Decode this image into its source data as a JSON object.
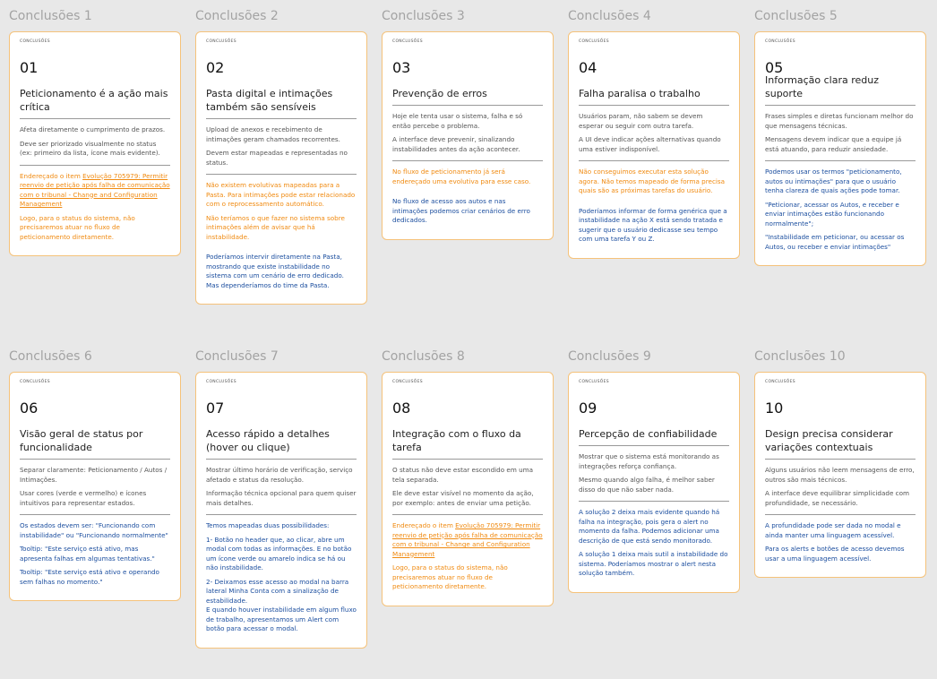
{
  "tag": "CONCLUSÕES",
  "cards": [
    {
      "title": "Conclusões 1",
      "num": "01",
      "heading": "Peticionamento é a ação mais crítica",
      "body": [
        "Afeta diretamente o cumprimento de prazos.",
        "Deve ser priorizado visualmente no status (ex: primeiro da lista, ícone mais evidente)."
      ],
      "orange": [
        {
          "pre": "Endereçado o item ",
          "link": "Evolução 705979: Permitir reenvio de petição após falha de comunicação com o tribunal - Change and Configuration Management"
        },
        {
          "text": "Logo, para o status do sistema, não precisaremos atuar no fluxo de peticionamento diretamente."
        }
      ],
      "blue": []
    },
    {
      "title": "Conclusões 2",
      "num": "02",
      "heading": "Pasta digital e intimações também são sensíveis",
      "body": [
        "Upload de anexos e recebimento de intimações geram chamados recorrentes.",
        "Devem estar mapeadas e representadas no status."
      ],
      "orange": [
        {
          "text": "Não existem evolutivas mapeadas para a Pasta. Para intimações pode estar relacionado com o reprocessamento automático."
        },
        {
          "text": "Não teríamos o que fazer no sistema sobre intimações além de avisar que há instabilidade."
        }
      ],
      "blue": [
        "Poderíamos intervir diretamente na Pasta, mostrando que existe instabilidade no sistema com um cenário de erro dedicado. Mas dependeríamos do time da Pasta."
      ]
    },
    {
      "title": "Conclusões 3",
      "num": "03",
      "heading": "Prevenção de erros",
      "body": [
        "Hoje ele tenta usar o sistema, falha e só então percebe o problema.",
        "A interface deve prevenir, sinalizando instabilidades antes da ação acontecer."
      ],
      "orange": [
        {
          "text": "No fluxo de peticionamento já será endereçado uma evolutiva para esse caso."
        }
      ],
      "blue": [
        "No fluxo de acesso aos autos e nas intimações podemos criar cenários de erro dedicados."
      ]
    },
    {
      "title": "Conclusões 4",
      "num": "04",
      "heading": "Falha paralisa o trabalho",
      "body": [
        "Usuários param, não sabem se devem esperar ou seguir com outra tarefa.",
        "A UI deve indicar ações alternativas quando uma estiver indisponível."
      ],
      "orange": [
        {
          "text": "Não conseguimos executar esta solução agora. Não temos mapeado de forma precisa quais são as próximas tarefas do usuário."
        }
      ],
      "blue": [
        "Poderíamos informar de forma genérica que a instabilidade na ação X está sendo tratada e sugerir que o usuário dedicasse seu tempo com uma tarefa Y ou Z."
      ]
    },
    {
      "title": "Conclusões 5",
      "num": "05",
      "heading": "Informação clara reduz suporte",
      "body": [
        "Frases simples e diretas funcionam melhor do que mensagens técnicas.",
        "Mensagens devem indicar que a equipe já está atuando, para reduzir ansiedade."
      ],
      "orange": [],
      "blue": [
        "Podemos usar os termos \"peticionamento, autos ou intimações\" para que o usuário tenha clareza de quais ações pode tomar.",
        "\"Peticionar, acessar os Autos, e receber e enviar intimações estão funcionando normalmente\";",
        "\"Instabilidade em peticionar, ou acessar os Autos, ou receber e enviar intimações\""
      ]
    },
    {
      "title": "Conclusões 6",
      "num": "06",
      "heading": "Visão geral de status por funcionalidade",
      "body": [
        "Separar claramente: Peticionamento / Autos / Intimações.",
        "Usar cores (verde e vermelho) e ícones intuitivos para representar estados."
      ],
      "orange": [],
      "blue": [
        "Os estados devem ser: \"Funcionando com instabilidade\" ou \"Funcionando normalmente\"",
        "Tooltip: \"Este serviço está ativo, mas apresenta falhas em algumas tentativas.\"",
        "Tooltip: \"Este serviço está ativo e operando sem falhas no momento.\""
      ]
    },
    {
      "title": "Conclusões 7",
      "num": "07",
      "heading": "Acesso rápido a detalhes (hover ou clique)",
      "body": [
        "Mostrar último horário de verificação, serviço afetado e status da resolução.",
        "Informação técnica opcional para quem quiser mais detalhes."
      ],
      "orange": [],
      "blue": [
        "Temos mapeadas duas possibilidades:",
        "1- Botão no header que, ao clicar, abre um modal com todas as informações. E no botão um ícone verde ou amarelo indica se há ou não instabilidade.",
        "2- Deixamos esse acesso ao modal na barra lateral Minha Conta com a sinalização de estabilidade.\nE quando houver instabilidade em algum fluxo de trabalho, apresentamos um Alert com botão para acessar o modal."
      ]
    },
    {
      "title": "Conclusões 8",
      "num": "08",
      "heading": "Integração com o fluxo da tarefa",
      "body": [
        "O status não deve estar escondido em uma tela separada.",
        "Ele deve estar visível no momento da ação, por exemplo: antes de enviar uma petição."
      ],
      "orange": [
        {
          "pre": "Endereçado o item ",
          "link": "Evolução 705979: Permitir reenvio de petição após falha de comunicação com o tribunal - Change and Configuration Management"
        },
        {
          "text": "Logo, para o status do sistema, não precisaremos atuar no fluxo de peticionamento diretamente."
        }
      ],
      "blue": []
    },
    {
      "title": "Conclusões 9",
      "num": "09",
      "heading": "Percepção de confiabilidade",
      "body": [
        "Mostrar que o sistema está monitorando as integrações reforça confiança.",
        "Mesmo quando algo falha, é melhor saber disso do que não saber nada."
      ],
      "orange": [],
      "blue": [
        "A solução 2 deixa mais evidente quando há falha na integração, pois gera o alert no momento da falha. Podemos adicionar uma descrição de que está sendo monitorado.",
        "A solução 1 deixa mais sutil a instabilidade do sistema. Poderíamos mostrar o alert nesta solução também."
      ]
    },
    {
      "title": "Conclusões 10",
      "num": "10",
      "heading": "Design precisa considerar variações contextuais",
      "body": [
        "Alguns usuários não leem mensagens de erro, outros são mais técnicos.",
        "A interface deve equilibrar simplicidade com profundidade, se necessário."
      ],
      "orange": [],
      "blue": [
        "A profundidade pode ser dada no modal e ainda manter uma linguagem acessível.",
        "Para os alerts e botões de acesso devemos usar a uma linguagem acessível."
      ]
    }
  ]
}
